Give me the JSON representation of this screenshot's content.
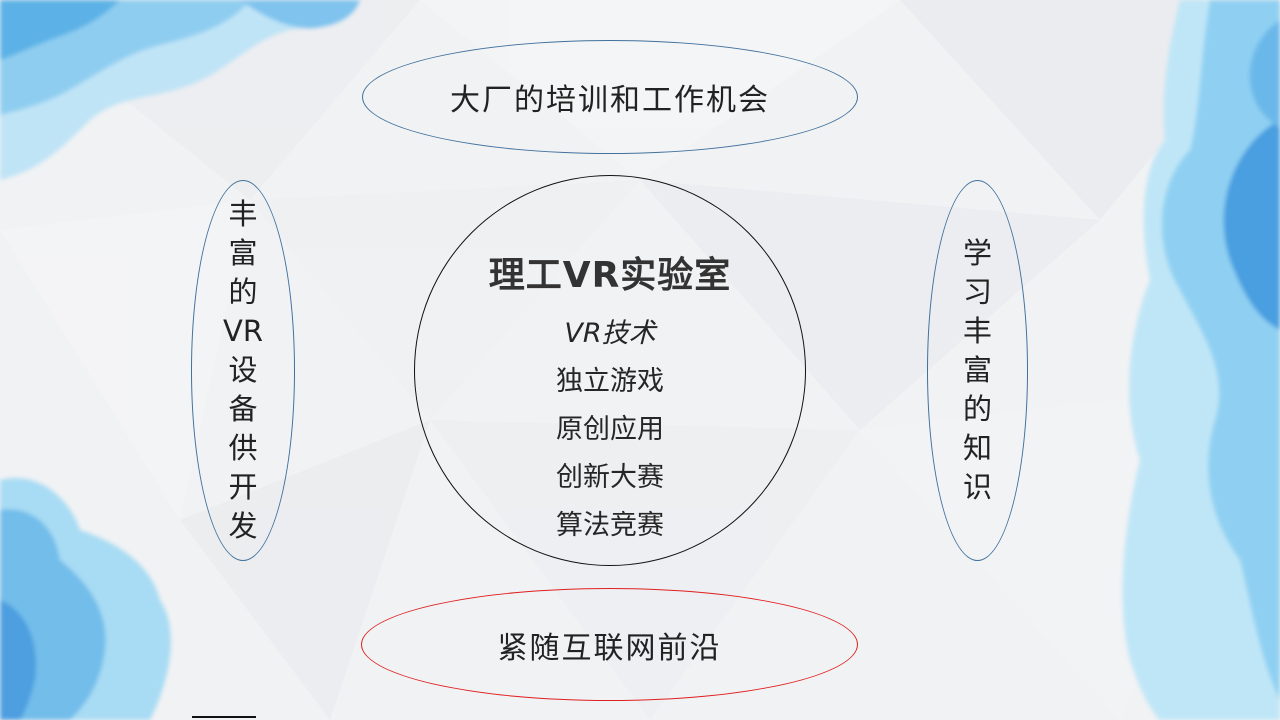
{
  "top_ellipse": {
    "text": "大厂的培训和工作机会"
  },
  "bottom_ellipse": {
    "text": "紧随互联网前沿"
  },
  "left_ellipse": {
    "chars": [
      "丰",
      "富",
      "的",
      "VR",
      "设",
      "备",
      "供",
      "开",
      "发"
    ]
  },
  "right_ellipse": {
    "chars": [
      "学",
      "习",
      "丰",
      "富",
      "的",
      "知",
      "识"
    ]
  },
  "center": {
    "title": "理工VR实验室",
    "items": [
      "VR技术",
      "独立游戏",
      "原创应用",
      "创新大赛",
      "算法竞赛"
    ]
  },
  "colors": {
    "ellipse_border": "#41719c",
    "bottom_border": "#e02020",
    "center_border": "#111111",
    "watercolor": "#5fb3e6"
  }
}
